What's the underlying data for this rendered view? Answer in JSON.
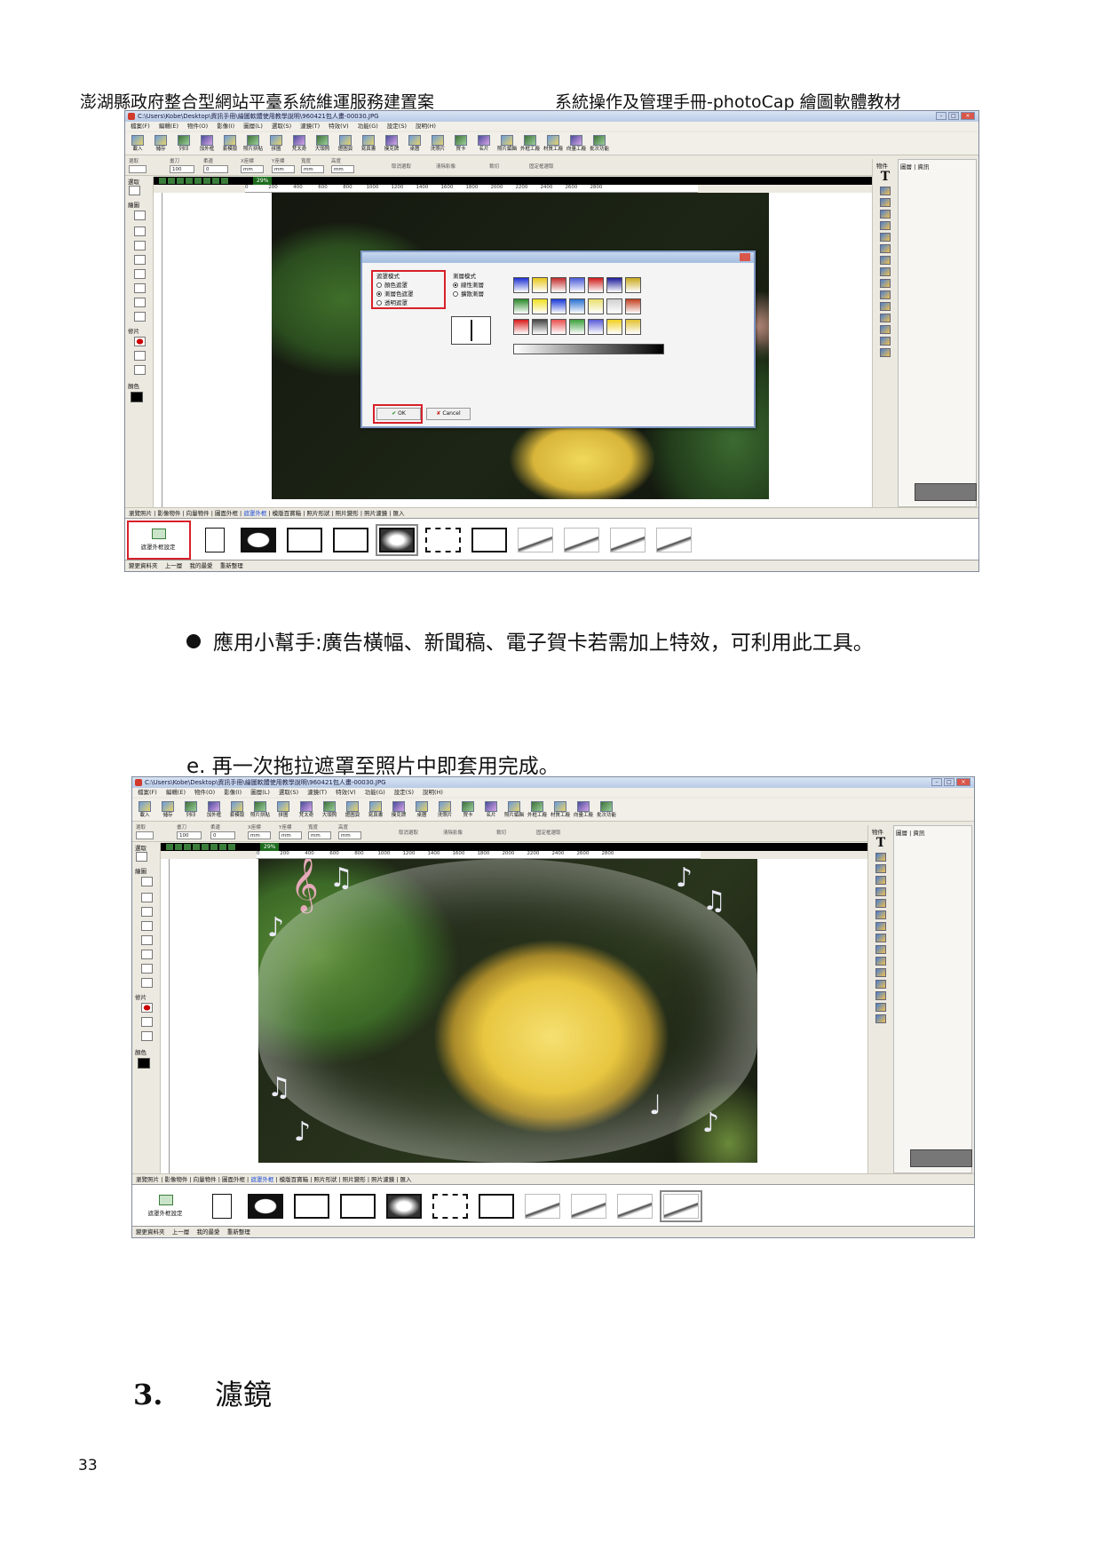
{
  "header": {
    "left": "澎湖縣政府整合型網站平臺系統維運服務建置案",
    "right": "系統操作及管理手冊-photoCap 繪圖軟體教材"
  },
  "app": {
    "title": "C:\\Users\\Kobe\\Desktop\\資訊手冊\\繪圖軟體使用教學說明\\960421包人畫-00030.JPG",
    "menu": [
      "檔案(F)",
      "編輯(E)",
      "物件(O)",
      "影像(I)",
      "圖層(L)",
      "選取(S)",
      "濾鏡(T)",
      "特效(V)",
      "功能(G)",
      "設定(S)",
      "說明(H)"
    ],
    "tools": [
      "載入",
      "儲存",
      "列印",
      "加外框",
      "套模版",
      "照片拼貼",
      "拼圖",
      "梵太奇",
      "大頭照",
      "證圖頁",
      "寫真書",
      "撲克牌",
      "桌曆",
      "洗照片",
      "賀卡",
      "名片",
      "照片編輯",
      "外框工廠",
      "材質工廠",
      "向量工廠",
      "批次功能"
    ],
    "options": {
      "labels": [
        "選取",
        "畫刀",
        "柔邊",
        "X座標",
        "Y座標",
        "寬度",
        "高度"
      ],
      "values": [
        "100",
        "0"
      ],
      "units": "mm",
      "actions": [
        "取消選取",
        "清除影像",
        "裁切",
        "固定框選取"
      ]
    },
    "left_labels": [
      "選取",
      "繪圖",
      "修片",
      "顏色"
    ],
    "zoom": "29%",
    "ruler": [
      "0",
      "200",
      "400",
      "600",
      "800",
      "1000",
      "1200",
      "1400",
      "1600",
      "1800",
      "2000",
      "2200",
      "2400",
      "2600",
      "2800"
    ],
    "right_panel": {
      "objects": "物件",
      "T": "T",
      "tabs": [
        "圖層",
        "資訊"
      ]
    },
    "tabs": [
      "瀏覽照片",
      "影像物件",
      "向量物件",
      "圖面外框",
      "遮罩外框",
      "模版百寶箱",
      "照片形狀",
      "照片變形",
      "照片濾鏡",
      "匯入"
    ],
    "active_tab": "遮罩外框",
    "frame_setting": "遮罩外框設定",
    "bottom": [
      "變更資料夾",
      "上一層",
      "我的最愛",
      "重新整理"
    ]
  },
  "dialog": {
    "mask_group": "遮罩模式",
    "mask_options": [
      "顏色遮罩",
      "漸層色遮罩",
      "透明遮罩"
    ],
    "gradient_group": "漸層模式",
    "gradient_options": [
      "線性漸層",
      "擴散漸層"
    ],
    "ok": "OK",
    "cancel": "Cancel",
    "palette": [
      "#1c2fd1",
      "#e7c51a",
      "#c02a2a",
      "#4a5ad8",
      "#cf1a1a",
      "#1d1d9a",
      "#c9a81e",
      "#2a8a2a",
      "#f0e020",
      "#1a3ad8",
      "#2a70d0",
      "#e9e070",
      "#d0d0d0",
      "#c04020",
      "#d81a1a",
      "#444444",
      "#e85050",
      "#3ca03c",
      "#5a5ad8",
      "#f0d020",
      "#e0c030"
    ]
  },
  "body": {
    "bullet": "應用小幫手:廣告橫幅、新聞稿、電子賀卡若需加上特效，可利用此工具。",
    "step_e": "e.  再一次拖拉遮罩至照片中即套用完成。",
    "section_num": "3.",
    "section_title": "濾鏡",
    "page_no": "33"
  }
}
